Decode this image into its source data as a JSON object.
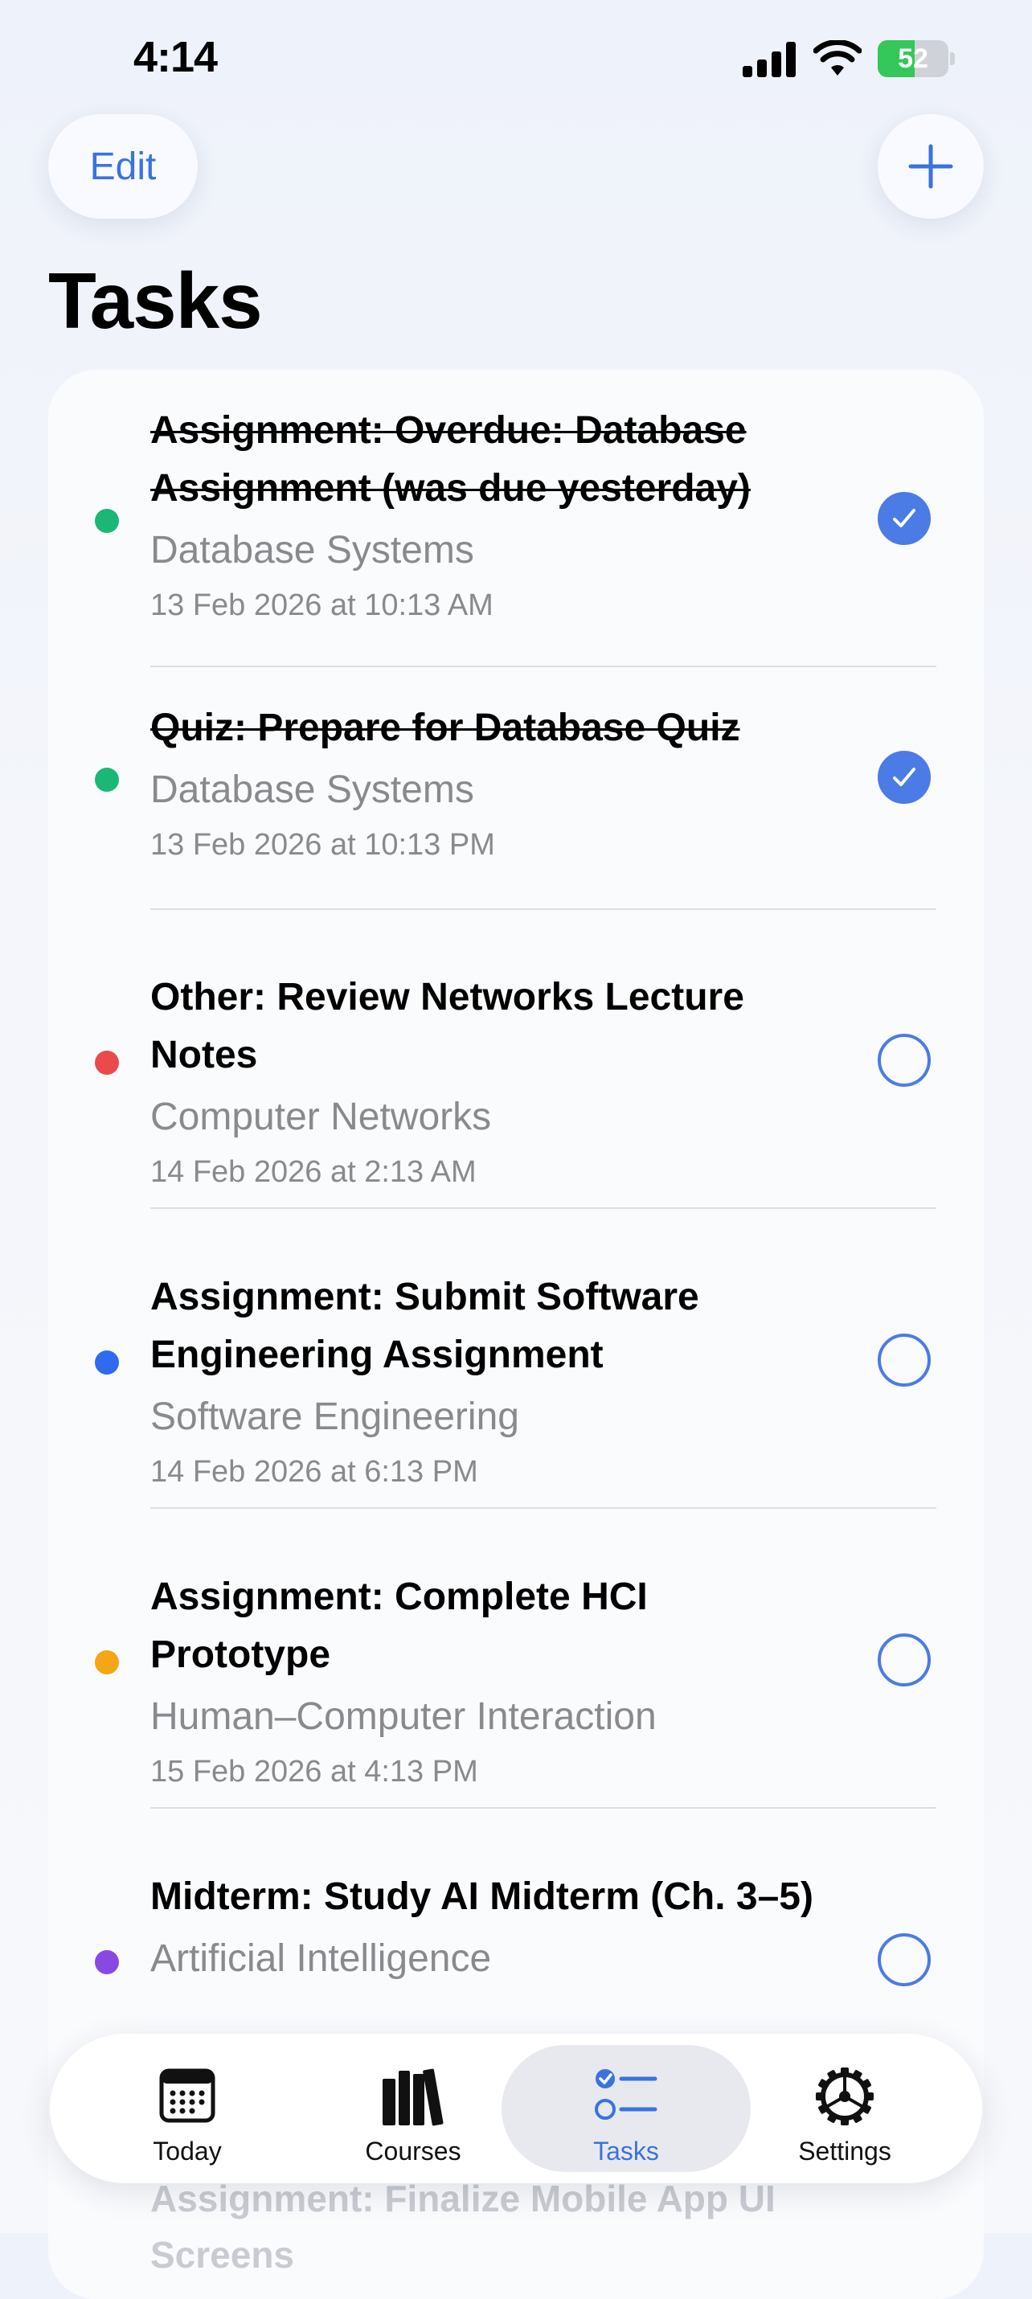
{
  "status_bar": {
    "time": "4:14",
    "battery": "52",
    "battery_level": 0.52
  },
  "header": {
    "edit_label": "Edit",
    "add_icon": "plus-icon"
  },
  "page_title": "Tasks",
  "colors": {
    "accent": "#3b72e0",
    "course_database": "#1bb776",
    "course_networks": "#ea4a4a",
    "course_software": "#2f6af0",
    "course_hci": "#f4a614",
    "course_ai": "#8a48e3"
  },
  "tasks": [
    {
      "title": "Assignment: Overdue: Database Assignment (was due yesterday)",
      "course": "Database Systems",
      "due": "13 Feb 2026 at 10:13 AM",
      "completed": true,
      "color": "#1bb776"
    },
    {
      "title": "Quiz: Prepare for Database Quiz",
      "course": "Database Systems",
      "due": "13 Feb 2026 at 10:13 PM",
      "completed": true,
      "color": "#1bb776"
    },
    {
      "title": "Other: Review Networks Lecture Notes",
      "course": "Computer Networks",
      "due": "14 Feb 2026 at 2:13 AM",
      "completed": false,
      "color": "#ea4a4a"
    },
    {
      "title": "Assignment: Submit Software Engineering Assignment",
      "course": "Software Engineering",
      "due": "14 Feb 2026 at 6:13 PM",
      "completed": false,
      "color": "#2f6af0"
    },
    {
      "title": "Assignment: Complete HCI Prototype",
      "course": "Human–Computer Interaction",
      "due": "15 Feb 2026 at 4:13 PM",
      "completed": false,
      "color": "#f4a614"
    },
    {
      "title": "Midterm: Study AI Midterm (Ch. 3–5)",
      "course": "Artificial Intelligence",
      "due": "",
      "completed": false,
      "color": "#8a48e3"
    }
  ],
  "peek_task_title": "Assignment: Finalize Mobile App UI Screens",
  "tab_bar": [
    {
      "label": "Today",
      "icon": "calendar-icon",
      "active": false
    },
    {
      "label": "Courses",
      "icon": "books-icon",
      "active": false
    },
    {
      "label": "Tasks",
      "icon": "checklist-icon",
      "active": true
    },
    {
      "label": "Settings",
      "icon": "gear-icon",
      "active": false
    }
  ]
}
